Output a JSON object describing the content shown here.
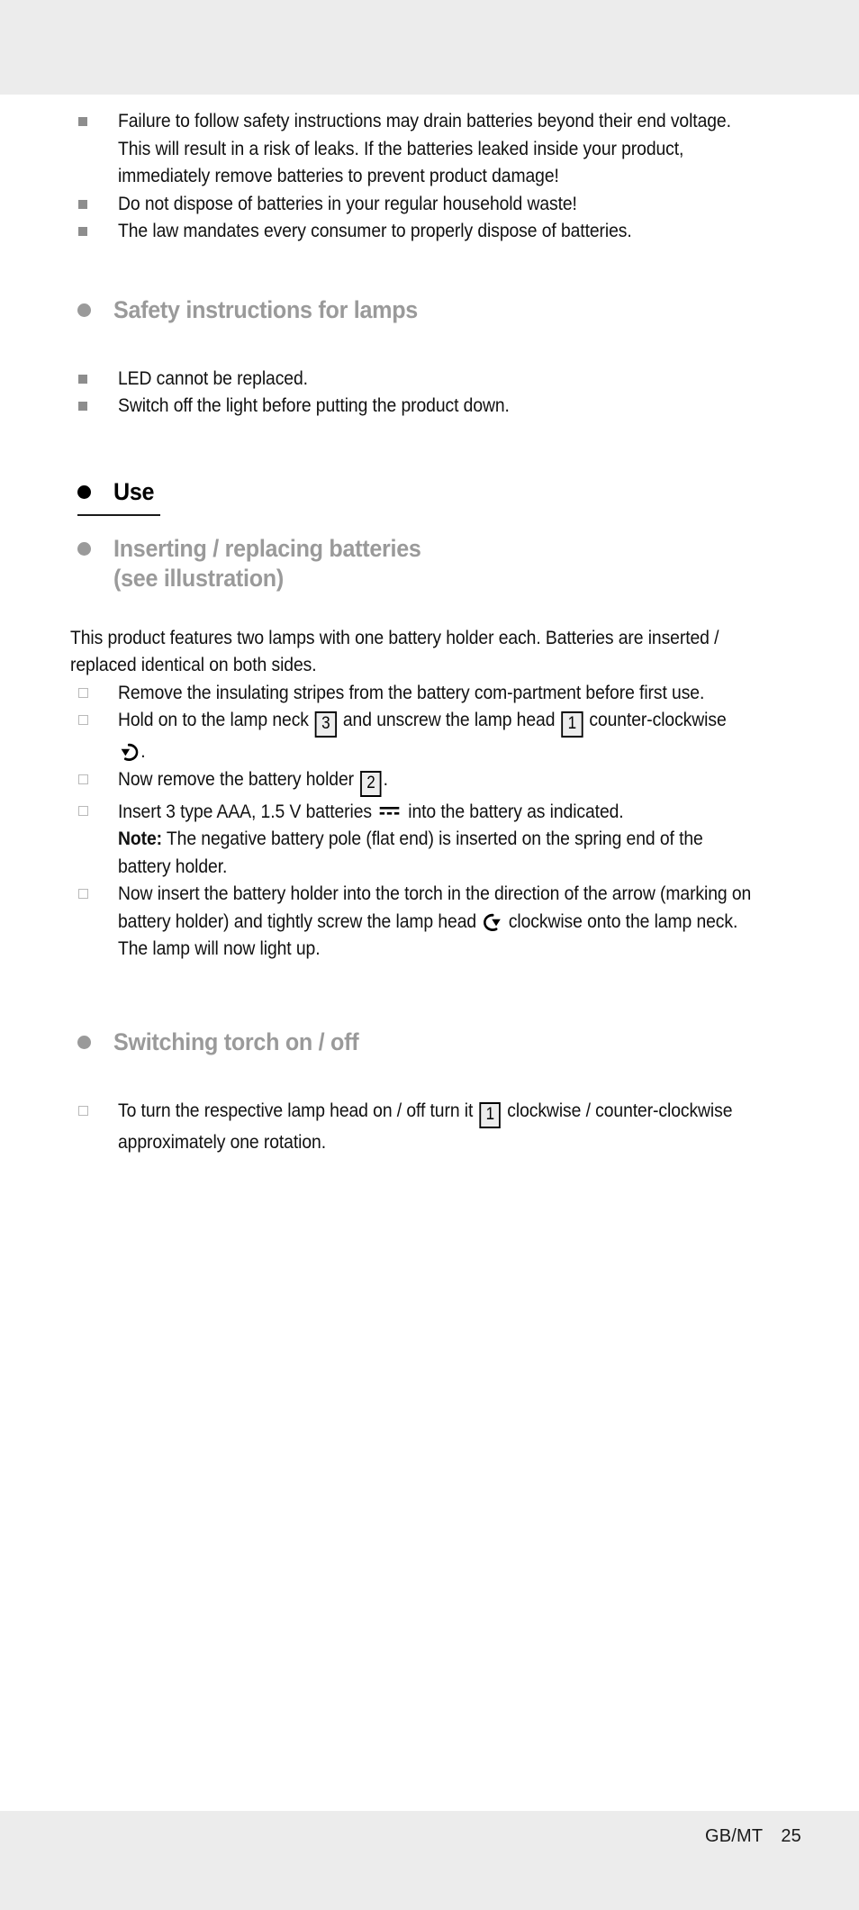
{
  "page": {
    "footer_locale": "GB/MT",
    "footer_page_number": "25",
    "background": "#ffffff",
    "band_color": "#ececec",
    "heading_gray": "#9a9a9a",
    "bullet_gray": "#8d8d8d"
  },
  "battery_warnings": {
    "items": [
      "Failure to follow safety instructions may drain batteries beyond their end voltage. This will result in a risk of leaks. If the batteries leaked inside your product, immediately remove batteries to prevent product damage!",
      "Do not dispose of batteries in your regular household waste!",
      "The law mandates every consumer to properly dispose of batteries."
    ]
  },
  "lamp_safety": {
    "heading": "Safety instructions for lamps",
    "items": [
      "LED cannot be replaced.",
      "Switch off the light before putting the product down."
    ]
  },
  "use": {
    "heading": "Use"
  },
  "inserting": {
    "heading_line1": "Inserting / replacing batteries",
    "heading_line2": "(see illustration)",
    "intro": "This product features two lamps with one battery holder each. Batteries are inserted / replaced identical on both sides.",
    "steps": [
      {
        "parts": [
          {
            "type": "text",
            "value": "Remove the insulating stripes from the battery com-partment before first use."
          }
        ]
      },
      {
        "parts": [
          {
            "type": "text",
            "value": "Hold on to the lamp neck "
          },
          {
            "type": "numbox",
            "value": "3"
          },
          {
            "type": "text",
            "value": " and unscrew the lamp head "
          },
          {
            "type": "numbox",
            "value": "1"
          },
          {
            "type": "text",
            "value": " counter-clockwise "
          },
          {
            "type": "icon",
            "value": "rotate-counter-clockwise-icon"
          },
          {
            "type": "text",
            "value": "."
          }
        ]
      },
      {
        "parts": [
          {
            "type": "text",
            "value": "Now remove the battery holder "
          },
          {
            "type": "numbox",
            "value": "2"
          },
          {
            "type": "text",
            "value": "."
          }
        ]
      },
      {
        "parts": [
          {
            "type": "text",
            "value": "Insert 3 type AAA, 1.5 V batteries "
          },
          {
            "type": "icon",
            "value": "direct-current-icon"
          },
          {
            "type": "text",
            "value": " into the battery as indicated."
          }
        ],
        "note_label": "Note:",
        "note_text": " The negative battery pole (flat end) is inserted on the spring end of the battery holder."
      },
      {
        "parts": [
          {
            "type": "text",
            "value": "Now insert the battery holder into the torch in the direction of the arrow (marking on battery holder) and tightly screw the lamp head "
          },
          {
            "type": "icon",
            "value": "rotate-clockwise-icon"
          },
          {
            "type": "text",
            "value": " clockwise onto the lamp neck. The lamp will now light up."
          }
        ]
      }
    ]
  },
  "switching": {
    "heading": "Switching torch on / off",
    "steps": [
      {
        "parts": [
          {
            "type": "text",
            "value": "To turn the respective lamp head on / off turn it "
          },
          {
            "type": "numbox",
            "value": "1"
          },
          {
            "type": "text",
            "value": " clockwise / counter-clockwise approximately one rotation."
          }
        ]
      }
    ]
  }
}
